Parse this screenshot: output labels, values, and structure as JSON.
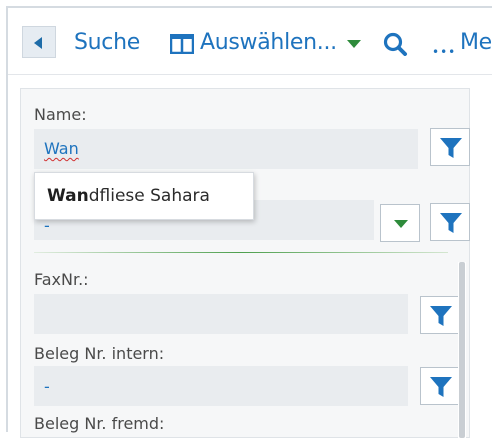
{
  "toolbar": {
    "back_label": "Suche",
    "select_label": "Auswählen...",
    "more_label": "Me"
  },
  "filters": {
    "name": {
      "label": "Name:",
      "value": "Wan"
    },
    "second": {
      "value": "-"
    },
    "fax": {
      "label": "FaxNr.:",
      "value": ""
    },
    "beleg_intern": {
      "label": "Beleg Nr. intern:",
      "value": "-"
    },
    "beleg_fremd": {
      "label": "Beleg Nr. fremd:"
    }
  },
  "autocomplete": {
    "match": "Wan",
    "rest": "dfliese Sahara"
  },
  "colors": {
    "accent": "#1e73be",
    "dropdown_arrow": "#2e8b3b",
    "panel_bg": "#f6f7f8",
    "field_bg": "#e9ecef"
  },
  "icons": {
    "back": "triangle-left-icon",
    "select": "columns-icon",
    "search": "search-icon",
    "more": "ellipsis-icon",
    "filter": "filter-funnel-icon",
    "dropdown": "caret-down-icon"
  }
}
